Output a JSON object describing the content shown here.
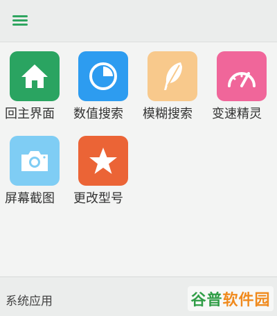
{
  "header": {
    "menu_icon": "hamburger-menu-icon",
    "accent_color": "#2ea55f"
  },
  "apps": [
    {
      "label": "回主界面",
      "icon": "home-icon",
      "color": "#2aa461"
    },
    {
      "label": "数值搜索",
      "icon": "pie-chart-icon",
      "color": "#2d9cf0"
    },
    {
      "label": "模糊搜索",
      "icon": "feather-icon",
      "color": "#f8c98c"
    },
    {
      "label": "变速精灵",
      "icon": "speedometer-icon",
      "color": "#f0669a"
    },
    {
      "label": "屏幕截图",
      "icon": "camera-icon",
      "color": "#7fcdf4"
    },
    {
      "label": "更改型号",
      "icon": "star-icon",
      "color": "#eb6436"
    }
  ],
  "footer": {
    "section_title": "系统应用",
    "watermark_part1": "谷普",
    "watermark_part2": "软件园"
  }
}
